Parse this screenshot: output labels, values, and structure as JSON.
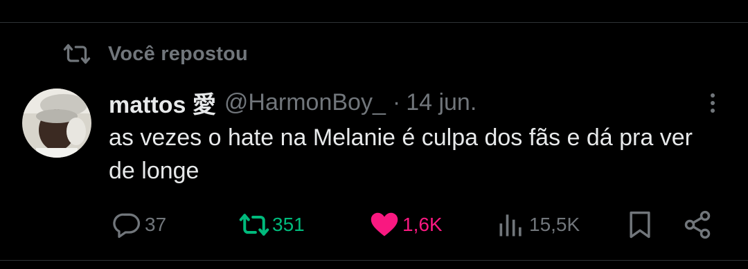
{
  "theme": {
    "background": "#000000",
    "text": "#e7e9ea",
    "muted": "#71767b",
    "repost_green": "#00ba7c",
    "like_pink": "#f91880",
    "divider": "#2f3336"
  },
  "repost_context": {
    "icon": "repost-icon",
    "label": "Você repostou"
  },
  "tweet": {
    "avatar": "avatar",
    "display_name": "mattos 愛",
    "handle": "@HarmonBoy_",
    "separator": "·",
    "date": "14 jun.",
    "more_icon": "more-vertical-icon",
    "text": "as vezes o hate na Melanie é culpa dos fãs e dá pra ver de longe"
  },
  "actions": {
    "reply": {
      "icon": "reply-icon",
      "count": "37"
    },
    "repost": {
      "icon": "repost-icon",
      "count": "351",
      "active": true
    },
    "like": {
      "icon": "heart-icon",
      "count": "1,6K",
      "active": true
    },
    "views": {
      "icon": "views-icon",
      "count": "15,5K"
    },
    "bookmark": {
      "icon": "bookmark-icon"
    },
    "share": {
      "icon": "share-icon"
    }
  }
}
